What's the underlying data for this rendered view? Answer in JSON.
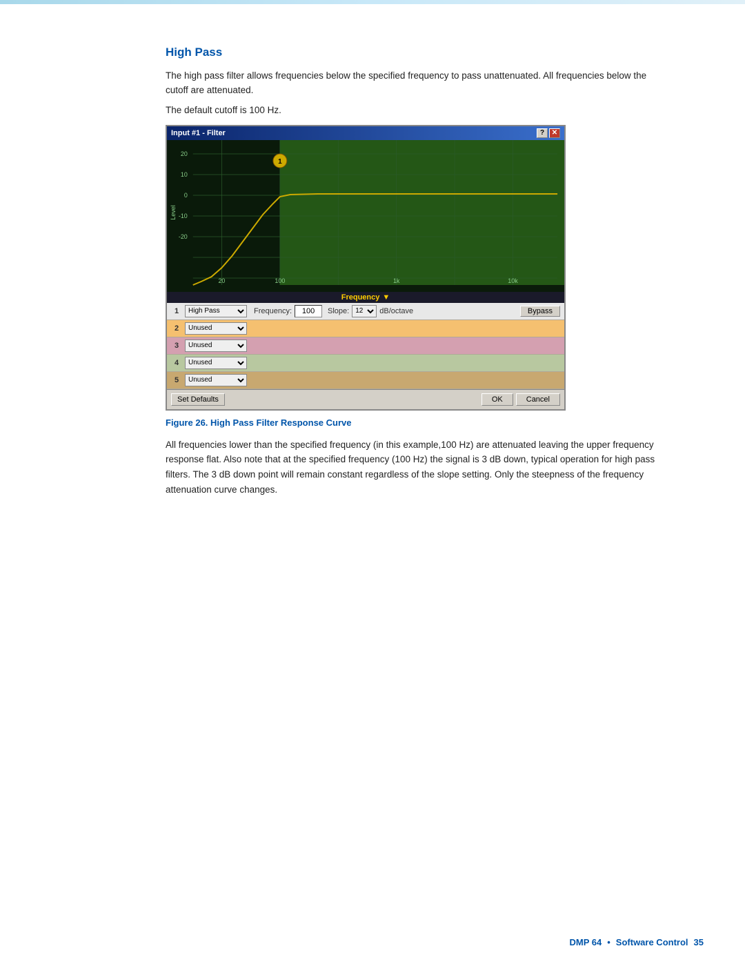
{
  "page": {
    "top_bar_visible": true
  },
  "section": {
    "title": "High Pass",
    "intro_text": "The high pass filter allows frequencies below the specified frequency to pass unattenuated. All frequencies below the cutoff are attenuated.",
    "default_cutoff_text": "The default cutoff is 100 Hz."
  },
  "dialog": {
    "title": "Input #1 - Filter",
    "chart": {
      "y_axis_label": "Level",
      "x_axis_label": "Frequency",
      "y_ticks": [
        "20",
        "10",
        "0",
        "-10",
        "-20"
      ],
      "x_ticks": [
        "20",
        "100",
        "1k",
        "10k"
      ]
    },
    "filter_rows": [
      {
        "num": "1",
        "type": "High Pass",
        "frequency_label": "Frequency:",
        "frequency_value": "100",
        "slope_label": "Slope:",
        "slope_value": "12",
        "dboct_label": "dB/octave",
        "bypass_label": "Bypass",
        "color": "row-1"
      },
      {
        "num": "2",
        "type": "Unused",
        "color": "row-2"
      },
      {
        "num": "3",
        "type": "Unused",
        "color": "row-3"
      },
      {
        "num": "4",
        "type": "Unused",
        "color": "row-4"
      },
      {
        "num": "5",
        "type": "Unused",
        "color": "row-5"
      }
    ],
    "set_defaults_label": "Set Defaults",
    "ok_label": "OK",
    "cancel_label": "Cancel"
  },
  "figure": {
    "caption_bold": "Figure 26.",
    "caption_text": "  High Pass Filter Response Curve"
  },
  "description": {
    "text": "All frequencies lower than the specified frequency (in this example,100 Hz) are attenuated leaving the upper frequency response flat. Also note that at the specified frequency (100 Hz) the signal is 3 dB down, typical operation for high pass filters. The 3 dB down point will remain constant regardless of the slope setting. Only the steepness of the frequency attenuation curve changes."
  },
  "footer": {
    "product": "DMP 64",
    "bullet": "•",
    "section": "Software Control",
    "page": "35"
  }
}
